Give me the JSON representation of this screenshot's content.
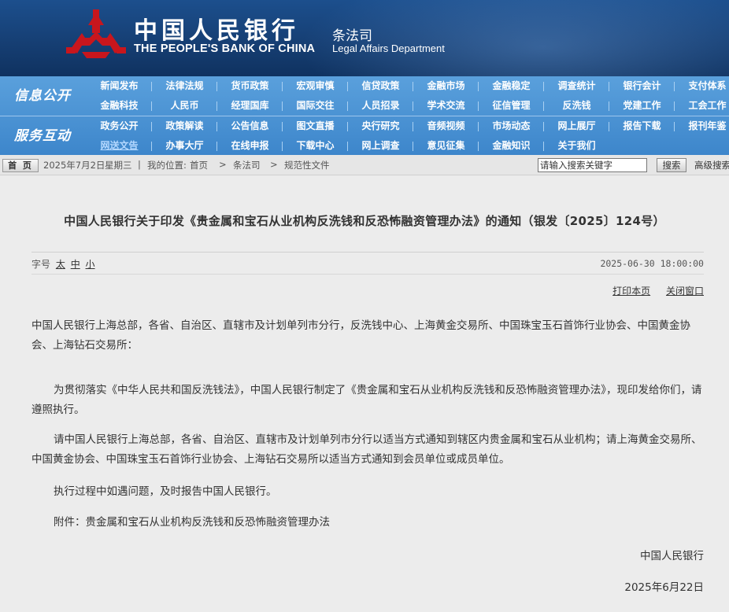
{
  "header": {
    "bank_name_cn": "中国人民银行",
    "bank_name_en": "THE PEOPLE'S BANK OF CHINA",
    "dept_cn": "条法司",
    "dept_en": "Legal Affairs Department",
    "colors": {
      "header_bg": "#163f74",
      "logo_red": "#c8161d",
      "nav_bg": "#4a92d4"
    }
  },
  "nav": {
    "section1_title": "信息公开",
    "section2_title": "服务互动",
    "row1": [
      "新闻发布",
      "法律法规",
      "货币政策",
      "宏观审慎",
      "信贷政策",
      "金融市场",
      "金融稳定",
      "调查统计",
      "银行会计",
      "支付体系"
    ],
    "row2": [
      "金融科技",
      "人民币",
      "经理国库",
      "国际交往",
      "人员招录",
      "学术交流",
      "征信管理",
      "反洗钱",
      "党建工作",
      "工会工作"
    ],
    "row3": [
      "政务公开",
      "政策解读",
      "公告信息",
      "图文直播",
      "央行研究",
      "音频视频",
      "市场动态",
      "网上展厅",
      "报告下载",
      "报刊年鉴"
    ],
    "row4": [
      "网送文告",
      "办事大厅",
      "在线申报",
      "下载中心",
      "网上调查",
      "意见征集",
      "金融知识",
      "关于我们"
    ]
  },
  "locbar": {
    "home_label": "首 页",
    "date": "2025年7月2日",
    "weekday": "星期三",
    "location_prefix": "我的位置:",
    "crumbs": [
      "首页",
      "条法司",
      "规范性文件"
    ],
    "crumb_sep": ">",
    "search_placeholder": "请输入搜索关键字",
    "search_button": "搜索",
    "advanced_search": "高级搜索"
  },
  "article": {
    "title": "中国人民银行关于印发《贵金属和宝石从业机构反洗钱和反恐怖融资管理办法》的通知（银发〔2025〕124号）",
    "font_size_label": "字号",
    "font_sizes": [
      "太",
      "中",
      "小"
    ],
    "publish_time": "2025-06-30 18:00:00",
    "print_label": "打印本页",
    "close_label": "关闭窗口",
    "addressee": "中国人民银行上海总部，各省、自治区、直辖市及计划单列市分行，反洗钱中心、上海黄金交易所、中国珠宝玉石首饰行业协会、中国黄金协会、上海钻石交易所：",
    "p1": "为贯彻落实《中华人民共和国反洗钱法》，中国人民银行制定了《贵金属和宝石从业机构反洗钱和反恐怖融资管理办法》，现印发给你们，请遵照执行。",
    "p2": "请中国人民银行上海总部，各省、自治区、直辖市及计划单列市分行以适当方式通知到辖区内贵金属和宝石从业机构；请上海黄金交易所、中国黄金协会、中国珠宝玉石首饰行业协会、上海钻石交易所以适当方式通知到会员单位或成员单位。",
    "p3": "执行过程中如遇问题，及时报告中国人民银行。",
    "p4": "附件：贵金属和宝石从业机构反洗钱和反恐怖融资管理办法",
    "signature": "中国人民银行",
    "sign_date": "2025年6月22日"
  }
}
